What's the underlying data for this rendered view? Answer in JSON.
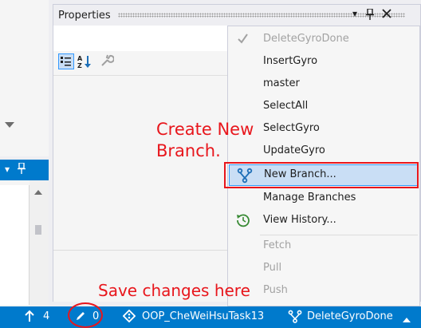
{
  "properties_panel": {
    "title": "Properties",
    "buttons": [
      "▾",
      "📌",
      "✕"
    ],
    "toolbar": [
      "categorized-icon",
      "alphabetical-icon",
      "property-pages-icon"
    ]
  },
  "left_panel": {
    "header_buttons": [
      "▾",
      "📌"
    ]
  },
  "branch_menu": {
    "items": [
      {
        "label": "DeleteGyroDone",
        "checked": true,
        "enabled": false
      },
      {
        "label": "InsertGyro",
        "enabled": true
      },
      {
        "label": "master",
        "enabled": true
      },
      {
        "label": "SelectAll",
        "enabled": true
      },
      {
        "label": "SelectGyro",
        "enabled": true
      },
      {
        "label": "UpdateGyro",
        "enabled": true
      },
      {
        "label": "New Branch...",
        "enabled": true,
        "icon": "branch-icon",
        "highlighted": true
      },
      {
        "label": "Manage Branches",
        "enabled": true
      },
      {
        "label": "View History...",
        "enabled": true,
        "icon": "history-icon"
      },
      {
        "label": "Fetch",
        "enabled": false
      },
      {
        "label": "Pull",
        "enabled": false
      },
      {
        "label": "Push",
        "enabled": false
      }
    ]
  },
  "annotations": {
    "create_line1": "Create New",
    "create_line2": "Branch.",
    "save": "Save changes here",
    "color": "#e8161c"
  },
  "status_bar": {
    "color": "#007acc",
    "unpublished_count": "4",
    "pending_changes": "0",
    "repository": "OOP_CheWeiHsuTask13",
    "branch": "DeleteGyroDone"
  }
}
